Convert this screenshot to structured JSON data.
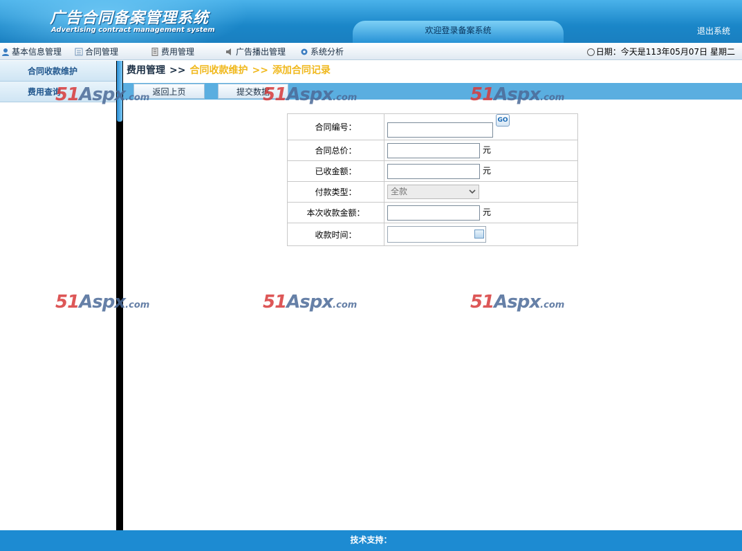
{
  "header": {
    "title_cn": "广告合同备案管理系统",
    "title_en": "Advertising contract management system",
    "welcome": "欢迎登录备案系统",
    "logout": "退出系统"
  },
  "nav": {
    "items": [
      {
        "label": "基本信息管理",
        "icon": "user-icon"
      },
      {
        "label": "合同管理",
        "icon": "list-icon"
      },
      {
        "label": "费用管理",
        "icon": "document-icon"
      },
      {
        "label": "广告播出管理",
        "icon": "speaker-icon"
      },
      {
        "label": "系统分析",
        "icon": "gear-icon"
      }
    ],
    "date": "日期：今天是113年05月07日 星期二"
  },
  "sidebar": {
    "items": [
      {
        "label": "合同收款维护"
      },
      {
        "label": "费用查询"
      }
    ]
  },
  "breadcrumb": {
    "home": "费用管理",
    "sep": ">>",
    "level2": "合同收款维护",
    "level3": "添加合同记录"
  },
  "toolbar": {
    "back": "返回上页",
    "submit": "提交数据"
  },
  "form": {
    "contract_no_label": "合同编号：",
    "go_label": "GO",
    "total_price_label": "合同总价：",
    "received_label": "已收金额：",
    "payment_type_label": "付款类型：",
    "payment_type_value": "全款",
    "this_payment_label": "本次收款金额：",
    "payment_time_label": "收款时间：",
    "unit": "元"
  },
  "watermark": {
    "n": "51",
    "a": "Aspx",
    "c": ".com"
  },
  "footer": {
    "text": "技术支持："
  }
}
